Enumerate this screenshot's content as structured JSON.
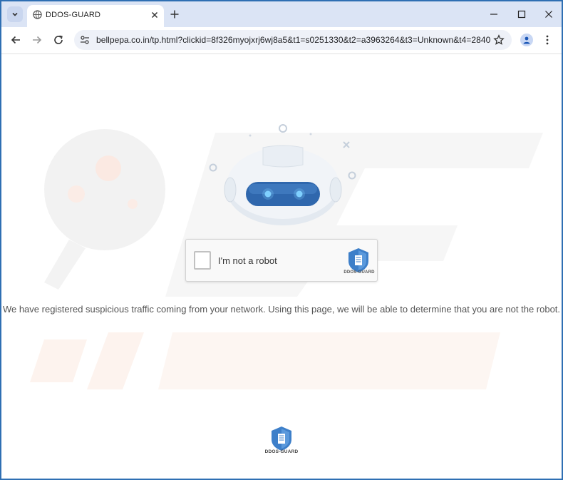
{
  "browser": {
    "tab": {
      "title": "DDOS-GUARD"
    },
    "address_bar": {
      "url": "bellpepa.co.in/tp.html?clickid=8f326myojxrj6wj8a5&t1=s0251330&t2=a3963264&t3=Unknown&t4=2840"
    },
    "icons": {
      "tab_search": "chevron-down-icon",
      "favicon": "globe-icon",
      "tab_close": "close-icon",
      "new_tab": "plus-icon",
      "minimize": "minimize-icon",
      "maximize": "maximize-icon",
      "close": "close-icon",
      "back": "arrow-left-icon",
      "forward": "arrow-right-icon",
      "reload": "reload-icon",
      "site_info": "tune-icon",
      "bookmark": "star-icon",
      "profile": "person-icon",
      "menu": "kebab-menu-icon"
    }
  },
  "captcha": {
    "label": "I'm not a robot",
    "checked": false,
    "logo_text": "DDOS-GUARD"
  },
  "message": "We have registered suspicious traffic coming from your network. Using this page, we will be able to determine that you are not the robot.",
  "footer": {
    "logo_text": "DDOS-GUARD"
  },
  "colors": {
    "window_border": "#2f6fb3",
    "tabstrip": "#dbe4f5",
    "shield_blue": "#3d7fc9",
    "robot_visor": "#2f67ad"
  }
}
